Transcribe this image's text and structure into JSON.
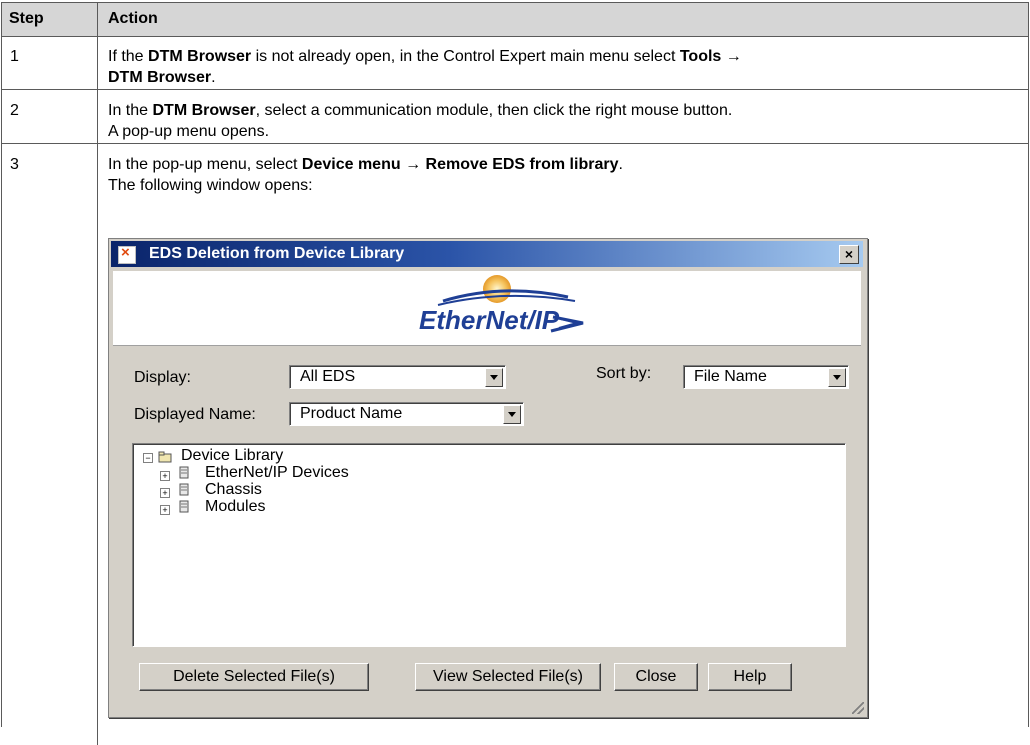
{
  "table": {
    "headers": [
      "Step",
      "Action"
    ],
    "rows": [
      {
        "step": "1",
        "line1": [
          "If the ",
          "DTM Browser",
          " is not already open, in the Control Expert main menu select ",
          "Tools →"
        ],
        "line2": [
          "DTM Browser",
          "."
        ]
      },
      {
        "step": "2",
        "line1": [
          "In the ",
          "DTM Browser",
          ", select a communication module, then click the right mouse button."
        ],
        "line2": "A pop-up menu opens."
      },
      {
        "step": "3",
        "line1": [
          "In the pop-up menu, select ",
          "Device menu → Remove EDS from library",
          "."
        ],
        "line2": "The following window opens:"
      }
    ]
  },
  "dialog": {
    "title": "EDS Deletion from Device Library",
    "close_glyph": "×",
    "logo_text": "EtherNet/IP",
    "display_label": "Display:",
    "display_value": "All EDS",
    "sortby_label": "Sort by:",
    "sortby_value": "File Name",
    "displayed_name_label": "Displayed Name:",
    "displayed_name_value": "Product Name",
    "tree": {
      "root": "Device Library",
      "children": [
        "EtherNet/IP Devices",
        "Chassis",
        "Modules"
      ]
    },
    "buttons": {
      "delete": "Delete Selected File(s)",
      "view": "View Selected File(s)",
      "close": "Close",
      "help": "Help"
    },
    "icons": [
      "app-icon",
      "close-icon",
      "expand-icon",
      "folder-icon",
      "device-icon",
      "resize-grip-icon"
    ]
  }
}
